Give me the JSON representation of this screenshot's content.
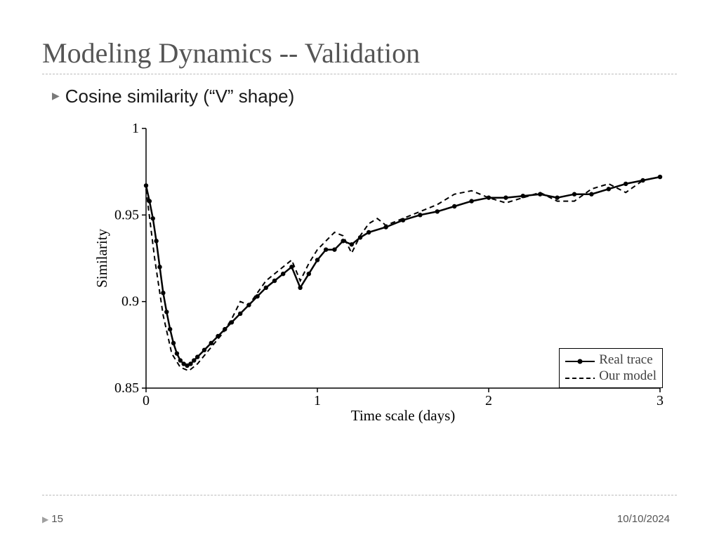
{
  "title": "Modeling Dynamics -- Validation",
  "bullet": "Cosine similarity (“V” shape)",
  "footer": {
    "slide_number": "15",
    "date": "10/10/2024"
  },
  "chart_data": {
    "type": "line",
    "title": "",
    "xlabel": "Time scale (days)",
    "ylabel": "Similarity",
    "xlim": [
      0,
      3
    ],
    "ylim": [
      0.85,
      1.0
    ],
    "xticks": [
      0,
      1,
      2,
      3
    ],
    "yticks": [
      0.85,
      0.9,
      0.95,
      1
    ],
    "legend": [
      "Real trace",
      "Our model"
    ],
    "series": [
      {
        "name": "Real trace",
        "style": "solid-markers",
        "x": [
          0.0,
          0.02,
          0.04,
          0.06,
          0.08,
          0.1,
          0.12,
          0.14,
          0.16,
          0.18,
          0.2,
          0.22,
          0.24,
          0.26,
          0.28,
          0.3,
          0.34,
          0.38,
          0.42,
          0.46,
          0.5,
          0.55,
          0.6,
          0.65,
          0.7,
          0.75,
          0.8,
          0.85,
          0.9,
          0.95,
          1.0,
          1.05,
          1.1,
          1.15,
          1.2,
          1.25,
          1.3,
          1.4,
          1.5,
          1.6,
          1.7,
          1.8,
          1.9,
          2.0,
          2.1,
          2.2,
          2.3,
          2.4,
          2.5,
          2.6,
          2.7,
          2.8,
          2.9,
          3.0
        ],
        "y": [
          0.967,
          0.958,
          0.948,
          0.935,
          0.92,
          0.905,
          0.894,
          0.884,
          0.876,
          0.87,
          0.866,
          0.864,
          0.863,
          0.864,
          0.866,
          0.868,
          0.872,
          0.876,
          0.88,
          0.884,
          0.888,
          0.893,
          0.898,
          0.903,
          0.908,
          0.912,
          0.916,
          0.92,
          0.908,
          0.916,
          0.924,
          0.93,
          0.93,
          0.935,
          0.933,
          0.937,
          0.94,
          0.943,
          0.947,
          0.95,
          0.952,
          0.955,
          0.958,
          0.96,
          0.96,
          0.961,
          0.962,
          0.96,
          0.962,
          0.962,
          0.965,
          0.968,
          0.97,
          0.972
        ]
      },
      {
        "name": "Our model",
        "style": "dashed",
        "x": [
          0.0,
          0.05,
          0.1,
          0.15,
          0.2,
          0.25,
          0.3,
          0.35,
          0.4,
          0.45,
          0.5,
          0.55,
          0.6,
          0.65,
          0.7,
          0.75,
          0.8,
          0.85,
          0.9,
          0.95,
          1.0,
          1.05,
          1.1,
          1.15,
          1.2,
          1.25,
          1.3,
          1.35,
          1.4,
          1.5,
          1.6,
          1.7,
          1.8,
          1.9,
          2.0,
          2.1,
          2.2,
          2.3,
          2.4,
          2.5,
          2.6,
          2.7,
          2.8,
          2.9,
          3.0
        ],
        "y": [
          0.965,
          0.925,
          0.892,
          0.87,
          0.862,
          0.86,
          0.864,
          0.87,
          0.876,
          0.882,
          0.89,
          0.9,
          0.898,
          0.905,
          0.912,
          0.916,
          0.92,
          0.924,
          0.912,
          0.922,
          0.93,
          0.935,
          0.94,
          0.938,
          0.928,
          0.938,
          0.945,
          0.948,
          0.944,
          0.948,
          0.952,
          0.956,
          0.962,
          0.964,
          0.96,
          0.957,
          0.96,
          0.963,
          0.958,
          0.958,
          0.965,
          0.968,
          0.963,
          0.97,
          0.972
        ]
      }
    ]
  }
}
